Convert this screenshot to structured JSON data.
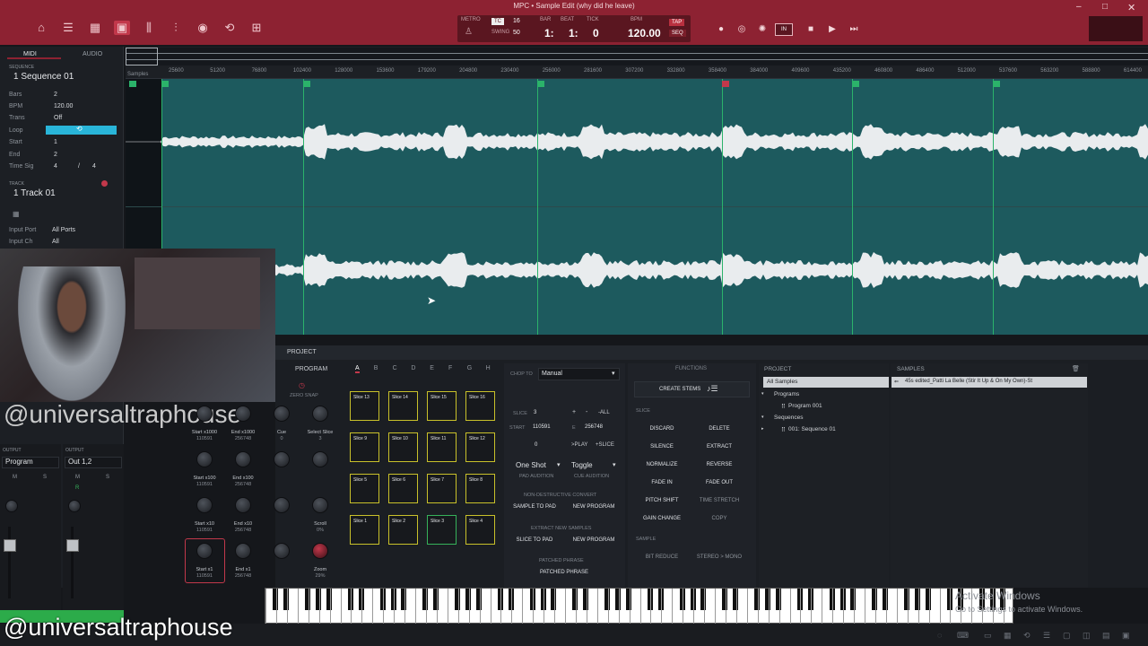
{
  "app": {
    "title": "MPC • Sample Edit (why did he leave)"
  },
  "transport": {
    "metro_label": "METRO",
    "tc_label": "TC",
    "tc_value": "16",
    "swing_label": "SWING",
    "swing_value": "50",
    "bar_label": "BAR",
    "beat_label": "BEAT",
    "tick_label": "TICK",
    "bpm_label": "BPM",
    "bar_value": "1:",
    "beat_value": "1:",
    "tick_value": "0",
    "bpm_value": "120.00",
    "tap_label": "TAP",
    "seq_label": "SEQ",
    "in_label": "IN"
  },
  "left_panel": {
    "tab_midi": "MIDI",
    "tab_audio": "AUDIO",
    "sequence_section": "SEQUENCE",
    "sequence_name": "1 Sequence 01",
    "bars_label": "Bars",
    "bars_value": "2",
    "bpm_label": "BPM",
    "bpm_value": "120.00",
    "trans_label": "Trans",
    "trans_value": "Off",
    "loop_label": "Loop",
    "start_label": "Start",
    "start_value": "1",
    "end_label": "End",
    "end_value": "2",
    "timesig_label": "Time Sig",
    "timesig_num": "4",
    "timesig_slash": "/",
    "timesig_den": "4",
    "track_section": "TRACK",
    "track_name": "1 Track 01",
    "input_port_label": "Input Port",
    "input_port_value": "All Ports",
    "input_ch_label": "Input Ch",
    "input_ch_value": "All",
    "output_label_1": "OUTPUT",
    "output_label_2": "OUTPUT",
    "output_value_1": "Program",
    "output_value_2": "Out 1,2",
    "mute_1": "M",
    "solo_1": "S",
    "mute_2": "M",
    "solo_2": "S",
    "strip_r": "R"
  },
  "ruler": {
    "samples_label": "Samples",
    "ticks": [
      "25600",
      "51200",
      "76800",
      "102400",
      "128000",
      "153600",
      "179200",
      "204800",
      "230400",
      "256000",
      "281600",
      "307200",
      "332800",
      "358400",
      "384000",
      "409600",
      "435200",
      "460800",
      "486400",
      "512000",
      "537600",
      "563200",
      "588800",
      "614400"
    ]
  },
  "project_header": {
    "label": "PROJECT"
  },
  "knobs": {
    "program_label": "PROGRAM",
    "zero_snap": "ZERO SNAP",
    "items": [
      {
        "label": "Start x1000",
        "value": "110591"
      },
      {
        "label": "End x1000",
        "value": "256748"
      },
      {
        "label": "Cue",
        "value": "0"
      },
      {
        "label": "Select Slice",
        "value": "3"
      },
      {
        "label": "Start x100",
        "value": "110591"
      },
      {
        "label": "End x100",
        "value": "256748"
      },
      {
        "label": "",
        "value": ""
      },
      {
        "label": "",
        "value": ""
      },
      {
        "label": "Start x10",
        "value": "110591"
      },
      {
        "label": "End x10",
        "value": "256748"
      },
      {
        "label": "",
        "value": ""
      },
      {
        "label": "Scroll",
        "value": "0%"
      },
      {
        "label": "Start x1",
        "value": "110591"
      },
      {
        "label": "End x1",
        "value": "256748"
      },
      {
        "label": "",
        "value": ""
      },
      {
        "label": "Zoom",
        "value": "29%"
      }
    ]
  },
  "pads": {
    "banks": [
      "A",
      "B",
      "C",
      "D",
      "E",
      "F",
      "G",
      "H"
    ],
    "rows": [
      [
        "Slice 13",
        "Slice 14",
        "Slice 15",
        "Slice 16"
      ],
      [
        "Slice 9",
        "Slice 10",
        "Slice 11",
        "Slice 12"
      ],
      [
        "Slice 5",
        "Slice 6",
        "Slice 7",
        "Slice 8"
      ],
      [
        "Slice 1",
        "Slice 2",
        "Slice 3",
        "Slice 4"
      ]
    ]
  },
  "chop": {
    "chop_to_label": "CHOP TO",
    "chop_to_value": "Manual",
    "slice_label": "SLICE",
    "slice_value": "3",
    "all_label": "ALL",
    "start_label": "START",
    "start_value": "110591",
    "end_label": "E",
    "end_value": "256748",
    "zero_value": "0",
    "play_label": "PLAY",
    "add_slice_label": "SLICE",
    "one_shot": "One Shot",
    "toggle": "Toggle",
    "pad_audition": "PAD AUDITION",
    "cue_audition": "CUE AUDITION",
    "nondestructive_label": "NON-DESTRUCTIVE CONVERT",
    "sample_to_pad": "SAMPLE TO PAD",
    "new_program_1": "NEW PROGRAM",
    "extract_label": "EXTRACT NEW SAMPLES",
    "slice_to_pad": "SLICE TO PAD",
    "new_program_2": "NEW PROGRAM",
    "patched_label": "PATCHED PHRASE",
    "patched_btn": "PATCHED PHRASE"
  },
  "functions": {
    "header": "FUNCTIONS",
    "create_stems": "CREATE STEMS",
    "slice_section": "SLICE",
    "discard": "DISCARD",
    "delete": "DELETE",
    "silence": "SILENCE",
    "extract": "EXTRACT",
    "normalize": "NORMALIZE",
    "reverse": "REVERSE",
    "fade_in": "FADE IN",
    "fade_out": "FADE OUT",
    "pitch_shift": "PITCH SHIFT",
    "time_stretch": "TIME STRETCH",
    "gain_change": "GAIN CHANGE",
    "copy": "COPY",
    "sample_section": "SAMPLE",
    "bit_reduce": "BIT REDUCE",
    "stereo_mono": "STEREO > MONO"
  },
  "project_tree": {
    "header": "PROJECT",
    "all_samples": "All Samples",
    "programs": "Programs",
    "program_001": "Program 001",
    "sequences": "Sequences",
    "sequence_001": "001: Sequence 01"
  },
  "samples": {
    "header": "SAMPLES",
    "item": "45s edited_Patti La Belle (Stir It Up & On My Own)-St"
  },
  "overlay": {
    "handle_top": "@universaltraphouse",
    "handle_bottom": "@universaltraphouse",
    "activate_title": "Activate Windows",
    "activate_sub": "Go to Settings to activate Windows."
  },
  "colors": {
    "brand": "#8d2232",
    "region": "#1d5a5e",
    "slice_marker": "#2bb36a",
    "pad_border": "#c9c12a",
    "loop_on": "#29b5d9"
  }
}
